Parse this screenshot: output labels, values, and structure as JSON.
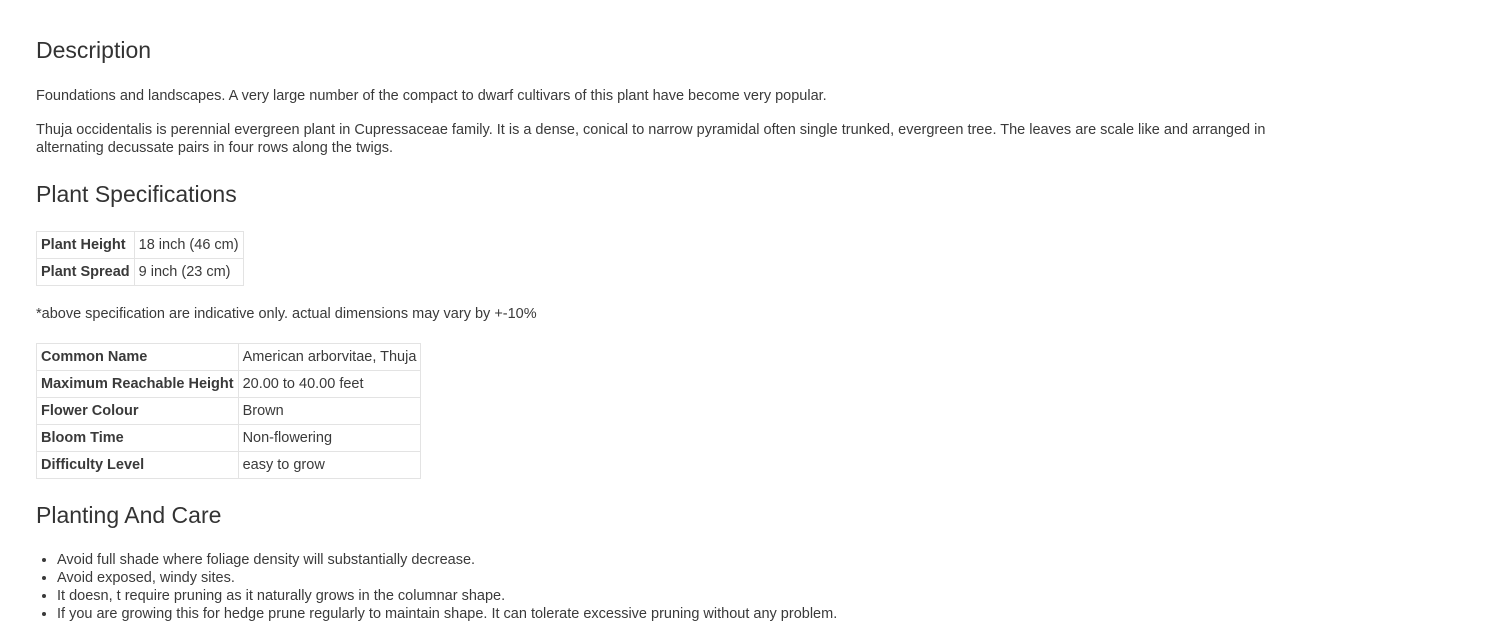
{
  "description": {
    "heading": "Description",
    "paragraphs": [
      "Foundations and landscapes. A very large number of the compact to dwarf cultivars of this plant have become very popular.",
      "Thuja occidentalis is perennial evergreen plant in Cupressaceae family. It is a dense, conical to narrow pyramidal often single trunked, evergreen tree. The leaves are scale like and arranged in alternating decussate pairs in four rows along the twigs."
    ]
  },
  "specifications": {
    "heading": "Plant Specifications",
    "size_table": [
      {
        "label": "Plant Height",
        "value": "18 inch (46 cm)"
      },
      {
        "label": "Plant Spread",
        "value": "9 inch (23 cm)"
      }
    ],
    "note": "*above specification are indicative only. actual dimensions may vary by +-10%",
    "details_table": [
      {
        "label": "Common Name",
        "value": "American arborvitae, Thuja"
      },
      {
        "label": "Maximum Reachable Height",
        "value": "20.00 to 40.00 feet"
      },
      {
        "label": "Flower Colour",
        "value": "Brown"
      },
      {
        "label": "Bloom Time",
        "value": "Non-flowering"
      },
      {
        "label": "Difficulty Level",
        "value": "easy to grow"
      }
    ]
  },
  "care": {
    "heading": "Planting And Care",
    "items": [
      "Avoid full shade where foliage density will substantially decrease.",
      "Avoid exposed, windy sites.",
      "It doesn, t require pruning as it naturally grows in the columnar shape.",
      "If you are growing this for hedge prune regularly to maintain shape. It can tolerate excessive pruning without any problem."
    ]
  }
}
